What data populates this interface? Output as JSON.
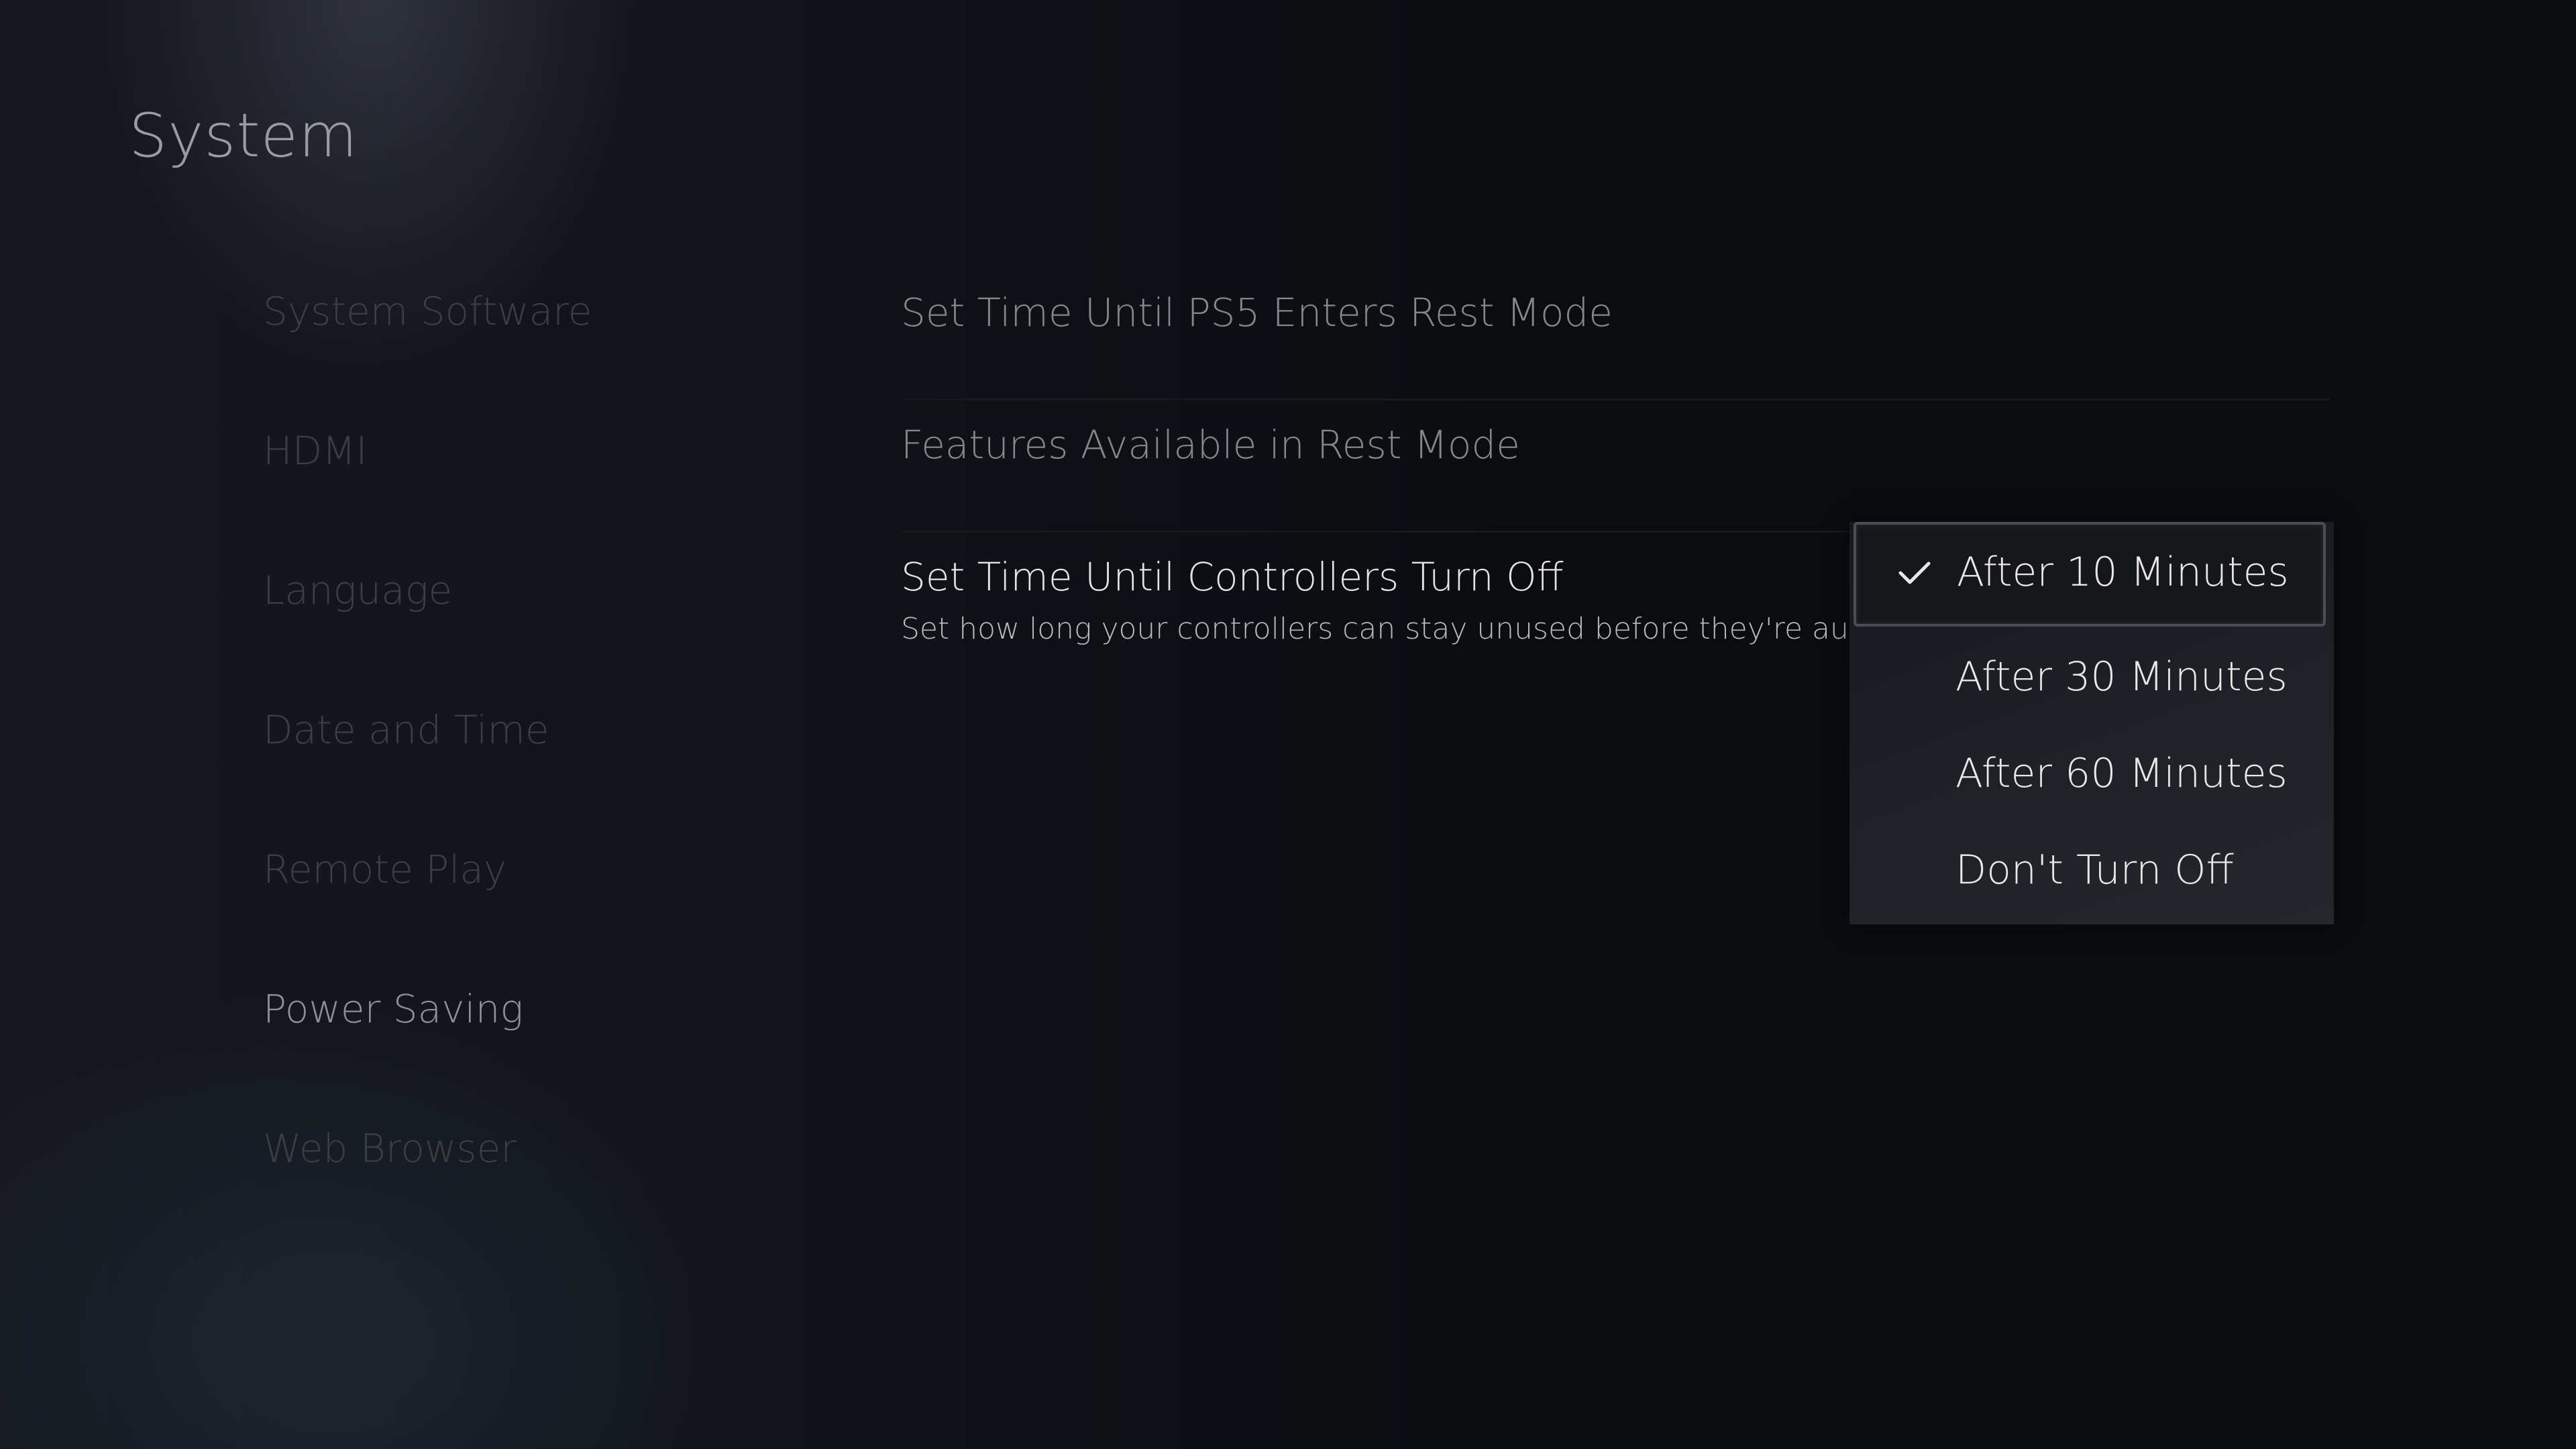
{
  "header": {
    "title": "System"
  },
  "sidebar": {
    "items": [
      {
        "label": "System Software",
        "active": false
      },
      {
        "label": "HDMI",
        "active": false
      },
      {
        "label": "Language",
        "active": false
      },
      {
        "label": "Date and Time",
        "active": false
      },
      {
        "label": "Remote Play",
        "active": false
      },
      {
        "label": "Power Saving",
        "active": true
      },
      {
        "label": "Web Browser",
        "active": false
      }
    ]
  },
  "main": {
    "settings": [
      {
        "label": "Set Time Until PS5 Enters Rest Mode"
      },
      {
        "label": "Features Available in Rest Mode"
      },
      {
        "label": "Set Time Until Controllers Turn Off",
        "description": "Set how long your controllers can stay unused before they're automatically turned off.",
        "focused": true
      }
    ]
  },
  "dropdown": {
    "selected_index": 0,
    "selected_icon": "check-icon",
    "options": [
      {
        "label": "After 10 Minutes"
      },
      {
        "label": "After 30 Minutes"
      },
      {
        "label": "After 60 Minutes"
      },
      {
        "label": "Don't Turn Off"
      }
    ]
  }
}
